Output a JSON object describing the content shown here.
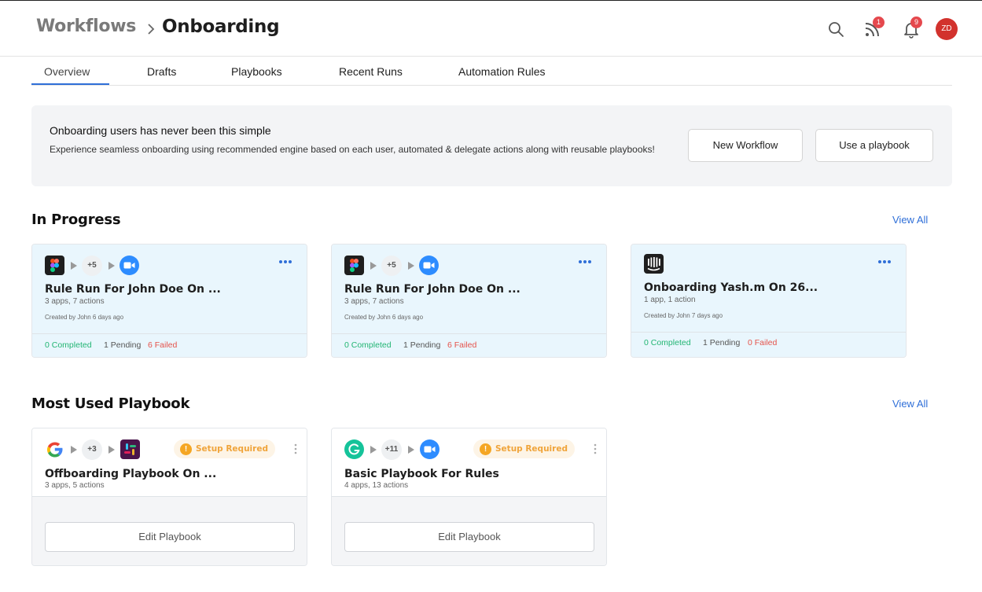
{
  "header": {
    "breadcrumb_parent": "Workflows",
    "breadcrumb_current": "Onboarding",
    "feed_badge": "1",
    "notification_badge": "9",
    "avatar_initials": "ZD"
  },
  "tabs": [
    {
      "label": "Overview",
      "active": true
    },
    {
      "label": "Drafts"
    },
    {
      "label": "Playbooks"
    },
    {
      "label": "Recent Runs"
    },
    {
      "label": "Automation Rules"
    }
  ],
  "hero": {
    "title": "Onboarding users has never been this simple",
    "description": "Experience seamless onboarding using recommended engine based on each user, automated & delegate actions along with reusable playbooks!",
    "new_workflow_label": "New Workflow",
    "use_playbook_label": "Use a playbook"
  },
  "in_progress": {
    "title": "In Progress",
    "view_all": "View All",
    "cards": [
      {
        "title": "Rule Run For John Doe On ...",
        "meta": "3 apps, 7 actions",
        "created": "Created by John 6 days ago",
        "extra_count": "+5",
        "completed": "0 Completed",
        "pending": "1 Pending",
        "failed": "6 Failed"
      },
      {
        "title": "Rule Run For John Doe On ...",
        "meta": "3 apps, 7 actions",
        "created": "Created by John 6 days ago",
        "extra_count": "+5",
        "completed": "0 Completed",
        "pending": "1 Pending",
        "failed": "6 Failed"
      },
      {
        "title": "Onboarding Yash.m On 26...",
        "meta": "1 app, 1 action",
        "created": "Created by John 7 days ago",
        "completed": "0 Completed",
        "pending": "1 Pending",
        "failed": "0 Failed"
      }
    ]
  },
  "most_used": {
    "title": "Most Used Playbook",
    "view_all": "View All",
    "cards": [
      {
        "title": "Offboarding Playbook On ...",
        "meta": "3 apps, 5 actions",
        "extra_count": "+3",
        "setup_label": "Setup Required",
        "edit_label": "Edit Playbook"
      },
      {
        "title": "Basic Playbook For Rules",
        "meta": "4 apps, 13 actions",
        "extra_count": "+11",
        "setup_label": "Setup Required",
        "edit_label": "Edit Playbook"
      }
    ]
  },
  "colors": {
    "accent": "#2f6fd8",
    "completed": "#22b573",
    "failed": "#e5534b",
    "warning": "#f5a623",
    "card_bg": "#e9f6fd"
  }
}
